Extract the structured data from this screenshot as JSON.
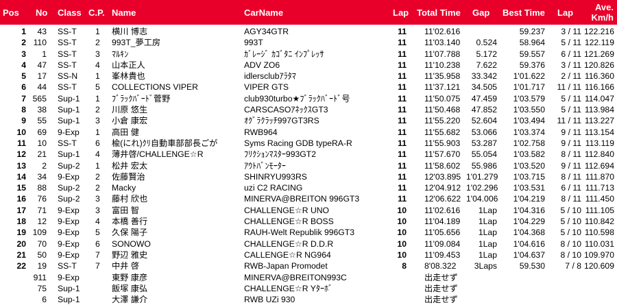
{
  "accent_color": "#e8002a",
  "header": {
    "pos": "Pos",
    "no": "No",
    "class": "Class",
    "cp": "C.P.",
    "name": "Name",
    "car": "CarName",
    "lap": "Lap",
    "total": "Total Time",
    "gap": "Gap",
    "best": "Best Time",
    "best_lap": "Lap",
    "ave1": "Ave.",
    "ave2": "Km/h"
  },
  "rows": [
    {
      "pos": "1",
      "no": "43",
      "cls": "SS-T",
      "cp": "1",
      "name": "横川 博志",
      "car": "AGY34GTR",
      "lap": "11",
      "total": "11'02.616",
      "gap": "",
      "best": "59.237",
      "blap": "3 / 11",
      "ave": "122.216"
    },
    {
      "pos": "2",
      "no": "110",
      "cls": "SS-T",
      "cp": "2",
      "name": "993T_夢工房",
      "car": "993T",
      "lap": "11",
      "total": "11'03.140",
      "gap": "0.524",
      "best": "58.964",
      "blap": "5 / 11",
      "ave": "122.119"
    },
    {
      "pos": "3",
      "no": "1",
      "cls": "SS-T",
      "cp": "3",
      "name": "ﾏﾙｷﾝ",
      "car": "ｶﾞﾚｰｼﾞ ｶｺﾞﾀﾆ ｲﾝﾌﾟﾚｯｻ",
      "lap": "11",
      "total": "11'07.788",
      "gap": "5.172",
      "best": "59.557",
      "blap": "6 / 11",
      "ave": "121.269"
    },
    {
      "pos": "4",
      "no": "47",
      "cls": "SS-T",
      "cp": "4",
      "name": "山本正人",
      "car": "ADV ZO6",
      "lap": "11",
      "total": "11'10.238",
      "gap": "7.622",
      "best": "59.376",
      "blap": "3 / 11",
      "ave": "120.826"
    },
    {
      "pos": "5",
      "no": "17",
      "cls": "SS-N",
      "cp": "1",
      "name": "峯林貴也",
      "car": "idlersclubｱﾗﾀﾏ",
      "lap": "11",
      "total": "11'35.958",
      "gap": "33.342",
      "best": "1'01.622",
      "blap": "2 / 11",
      "ave": "116.360"
    },
    {
      "pos": "6",
      "no": "44",
      "cls": "SS-T",
      "cp": "5",
      "name": "COLLECTIONS VIPER",
      "car": "VIPER GTS",
      "lap": "11",
      "total": "11'37.121",
      "gap": "34.505",
      "best": "1'01.717",
      "blap": "11 / 11",
      "ave": "116.166"
    },
    {
      "pos": "7",
      "no": "565",
      "cls": "Sup-1",
      "cp": "1",
      "name": "ﾌﾞﾗｯｸﾊﾞｰﾄﾞ菅野",
      "car": "club930turbo★ﾌﾞﾗｯｸﾊﾞｰﾄﾞ号",
      "lap": "11",
      "total": "11'50.075",
      "gap": "47.459",
      "best": "1'03.579",
      "blap": "5 / 11",
      "ave": "114.047"
    },
    {
      "pos": "8",
      "no": "38",
      "cls": "Sup-1",
      "cp": "2",
      "name": "川原 悠生",
      "car": "CARSCASOｱﾈｯｸｽGT3",
      "lap": "11",
      "total": "11'50.468",
      "gap": "47.852",
      "best": "1'03.550",
      "blap": "5 / 11",
      "ave": "113.984"
    },
    {
      "pos": "9",
      "no": "55",
      "cls": "Sup-1",
      "cp": "3",
      "name": "小倉 康宏",
      "car": "ｵｸﾞﾗｸﾗｯﾁ997GT3RS",
      "lap": "11",
      "total": "11'55.220",
      "gap": "52.604",
      "best": "1'03.494",
      "blap": "11 / 11",
      "ave": "113.227"
    },
    {
      "pos": "10",
      "no": "69",
      "cls": "9-Exp",
      "cp": "1",
      "name": "高田 健",
      "car": "RWB964",
      "lap": "11",
      "total": "11'55.682",
      "gap": "53.066",
      "best": "1'03.374",
      "blap": "9 / 11",
      "ave": "113.154"
    },
    {
      "pos": "11",
      "no": "10",
      "cls": "SS-T",
      "cp": "6",
      "name": "楡(にれ)ｸﾘ自動車部部長ごが",
      "car": "Syms Racing GDB typeRA-R",
      "lap": "11",
      "total": "11'55.903",
      "gap": "53.287",
      "best": "1'02.758",
      "blap": "9 / 11",
      "ave": "113.119"
    },
    {
      "pos": "12",
      "no": "21",
      "cls": "Sup-1",
      "cp": "4",
      "name": "薄井啓/CHALLENGE☆R",
      "car": "ﾌﾘｸｼｮﾝﾏｽﾀｰ993GT2",
      "lap": "11",
      "total": "11'57.670",
      "gap": "55.054",
      "best": "1'03.582",
      "blap": "8 / 11",
      "ave": "112.840"
    },
    {
      "pos": "13",
      "no": "2",
      "cls": "Sup-2",
      "cp": "1",
      "name": "松井 宏太",
      "car": "ｱｳﾄﾊﾞﾝﾓｰﾀｰ",
      "lap": "11",
      "total": "11'58.602",
      "gap": "55.986",
      "best": "1'03.520",
      "blap": "9 / 11",
      "ave": "112.694"
    },
    {
      "pos": "14",
      "no": "34",
      "cls": "9-Exp",
      "cp": "2",
      "name": "佐藤賢治",
      "car": "SHINRYU993RS",
      "lap": "11",
      "total": "12'03.895",
      "gap": "1'01.279",
      "best": "1'03.715",
      "blap": "8 / 11",
      "ave": "111.870"
    },
    {
      "pos": "15",
      "no": "88",
      "cls": "Sup-2",
      "cp": "2",
      "name": "Macky",
      "car": "uzi C2 RACING",
      "lap": "11",
      "total": "12'04.912",
      "gap": "1'02.296",
      "best": "1'03.531",
      "blap": "6 / 11",
      "ave": "111.713"
    },
    {
      "pos": "16",
      "no": "76",
      "cls": "Sup-2",
      "cp": "3",
      "name": "藤村 欣也",
      "car": "MINERVA@BREITON 996GT3",
      "lap": "11",
      "total": "12'06.622",
      "gap": "1'04.006",
      "best": "1'04.219",
      "blap": "8 / 11",
      "ave": "111.450"
    },
    {
      "pos": "17",
      "no": "71",
      "cls": "9-Exp",
      "cp": "3",
      "name": "富田 智",
      "car": "CHALLENGE☆R UNO",
      "lap": "10",
      "total": "11'02.616",
      "gap": "1Lap",
      "best": "1'04.316",
      "blap": "5 / 10",
      "ave": "111.105"
    },
    {
      "pos": "18",
      "no": "12",
      "cls": "9-Exp",
      "cp": "4",
      "name": "本橋 善行",
      "car": "CHALLENGE☆R BOSS",
      "lap": "10",
      "total": "11'04.189",
      "gap": "1Lap",
      "best": "1'04.229",
      "blap": "5 / 10",
      "ave": "110.842"
    },
    {
      "pos": "19",
      "no": "109",
      "cls": "9-Exp",
      "cp": "5",
      "name": "久保 陽子",
      "car": "RAUH-Welt Republik 996GT3",
      "lap": "10",
      "total": "11'05.656",
      "gap": "1Lap",
      "best": "1'04.368",
      "blap": "5 / 10",
      "ave": "110.598"
    },
    {
      "pos": "20",
      "no": "70",
      "cls": "9-Exp",
      "cp": "6",
      "name": "SONOWO",
      "car": "CHALLENGE☆R D.D.R",
      "lap": "10",
      "total": "11'09.084",
      "gap": "1Lap",
      "best": "1'04.616",
      "blap": "8 / 10",
      "ave": "110.031"
    },
    {
      "pos": "21",
      "no": "50",
      "cls": "9-Exp",
      "cp": "7",
      "name": "野辺 雅史",
      "car": "CALLENGE☆R NG964",
      "lap": "10",
      "total": "11'09.453",
      "gap": "1Lap",
      "best": "1'04.637",
      "blap": "8 / 10",
      "ave": "109.970"
    },
    {
      "pos": "22",
      "no": "19",
      "cls": "SS-T",
      "cp": "7",
      "name": "中井 啓",
      "car": "RWB-Japan Promodet",
      "lap": "8",
      "total": "8'08.322",
      "gap": "3Laps",
      "best": "59.530",
      "blap": "7 / 8",
      "ave": "120.609"
    },
    {
      "pos": "",
      "no": "911",
      "cls": "9-Exp",
      "cp": "",
      "name": "東野 康彦",
      "car": "MINERVA@BREITON993C",
      "lap": "",
      "total": "出走せず",
      "gap": "",
      "best": "",
      "blap": "",
      "ave": ""
    },
    {
      "pos": "",
      "no": "75",
      "cls": "Sup-1",
      "cp": "",
      "name": "飯塚 康弘",
      "car": "CHALLENGE☆R Yﾀｰﾎﾞ",
      "lap": "",
      "total": "出走せず",
      "gap": "",
      "best": "",
      "blap": "",
      "ave": ""
    },
    {
      "pos": "",
      "no": "6",
      "cls": "Sup-1",
      "cp": "",
      "name": "大澤 謙介",
      "car": "RWB UZi 930",
      "lap": "",
      "total": "出走せず",
      "gap": "",
      "best": "",
      "blap": "",
      "ave": ""
    }
  ]
}
